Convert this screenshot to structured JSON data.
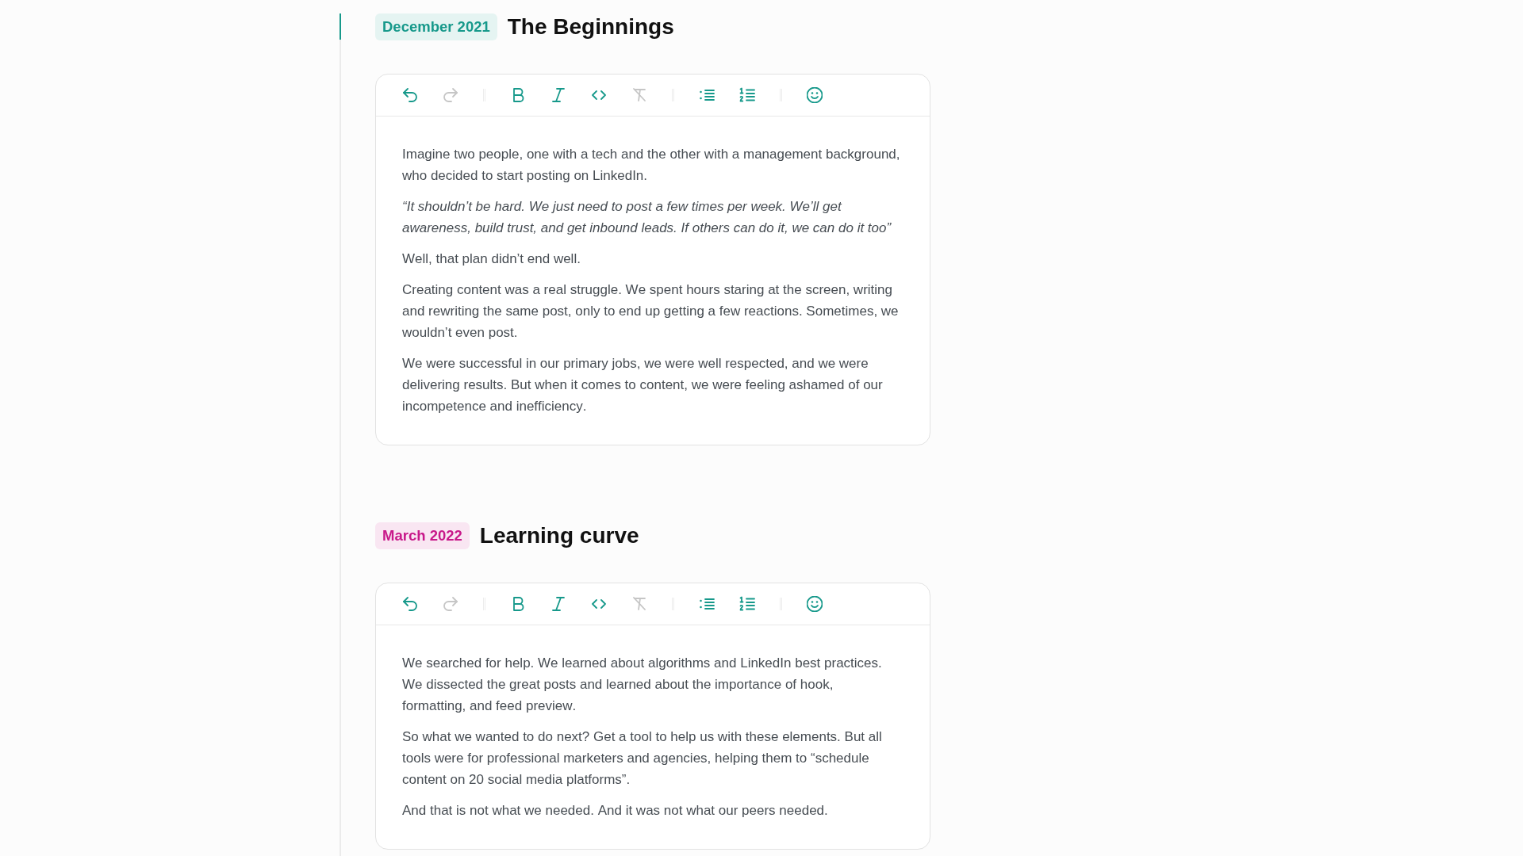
{
  "timeline": [
    {
      "date": "December 2021",
      "color": "#17998b",
      "title": "The Beginnings",
      "active": true,
      "toolbar": {
        "groups": [
          {
            "buttons": [
              {
                "kind": "undo",
                "disabled": false
              },
              {
                "kind": "redo",
                "disabled": true
              }
            ]
          },
          {
            "buttons": [
              {
                "kind": "bold",
                "disabled": false
              },
              {
                "kind": "italic",
                "disabled": false
              },
              {
                "kind": "code",
                "disabled": false
              },
              {
                "kind": "clear",
                "disabled": true
              }
            ]
          },
          {
            "buttons": [
              {
                "kind": "bullets",
                "disabled": false
              },
              {
                "kind": "numbers",
                "disabled": false
              }
            ]
          },
          {
            "buttons": [
              {
                "kind": "emoji",
                "disabled": false
              }
            ]
          }
        ]
      },
      "paragraphs": [
        {
          "text": "Imagine two people, one with a tech and the other with a management background, who decided to start posting on LinkedIn.",
          "italic": false
        },
        {
          "text": "“It shouldn’t be hard. We just need to post a few times per week. We’ll get awareness, build trust, and get inbound leads. If others can do it, we can do it too”",
          "italic": true
        },
        {
          "text": "Well, that plan didn’t end well.",
          "italic": false
        },
        {
          "text": "Creating content was a real struggle. We spent hours staring at the screen, writing and rewriting the same post, only to end up getting a few reactions. Sometimes, we wouldn’t even post.",
          "italic": false
        },
        {
          "text": "We were successful in our primary jobs, we were well respected, and we were delivering results. But when it comes to content, we were feeling ashamed of our incompetence and inefficiency.",
          "italic": false
        }
      ]
    },
    {
      "date": "March 2022",
      "color": "#c8198a",
      "title": "Learning curve",
      "active": false,
      "toolbar": {
        "groups": [
          {
            "buttons": [
              {
                "kind": "undo",
                "disabled": false
              },
              {
                "kind": "redo",
                "disabled": true
              }
            ]
          },
          {
            "buttons": [
              {
                "kind": "bold",
                "disabled": false
              },
              {
                "kind": "italic",
                "disabled": false
              },
              {
                "kind": "code",
                "disabled": false
              },
              {
                "kind": "clear",
                "disabled": true
              }
            ]
          },
          {
            "buttons": [
              {
                "kind": "bullets",
                "disabled": false
              },
              {
                "kind": "numbers",
                "disabled": false
              }
            ]
          },
          {
            "buttons": [
              {
                "kind": "emoji",
                "disabled": false
              }
            ]
          }
        ]
      },
      "paragraphs": [
        {
          "text": "We searched for help. We learned about algorithms and LinkedIn best practices. We dissected the great posts and learned about the importance of hook, formatting, and feed preview.",
          "italic": false
        },
        {
          "text": "So what we wanted to do next? Get a tool to help us with these elements. But all tools were for professional marketers and agencies, helping them to “schedule content on 20 social media platforms”.",
          "italic": false
        },
        {
          "text": "And that is not what we needed. And it was not what our peers needed.",
          "italic": false
        }
      ]
    }
  ]
}
